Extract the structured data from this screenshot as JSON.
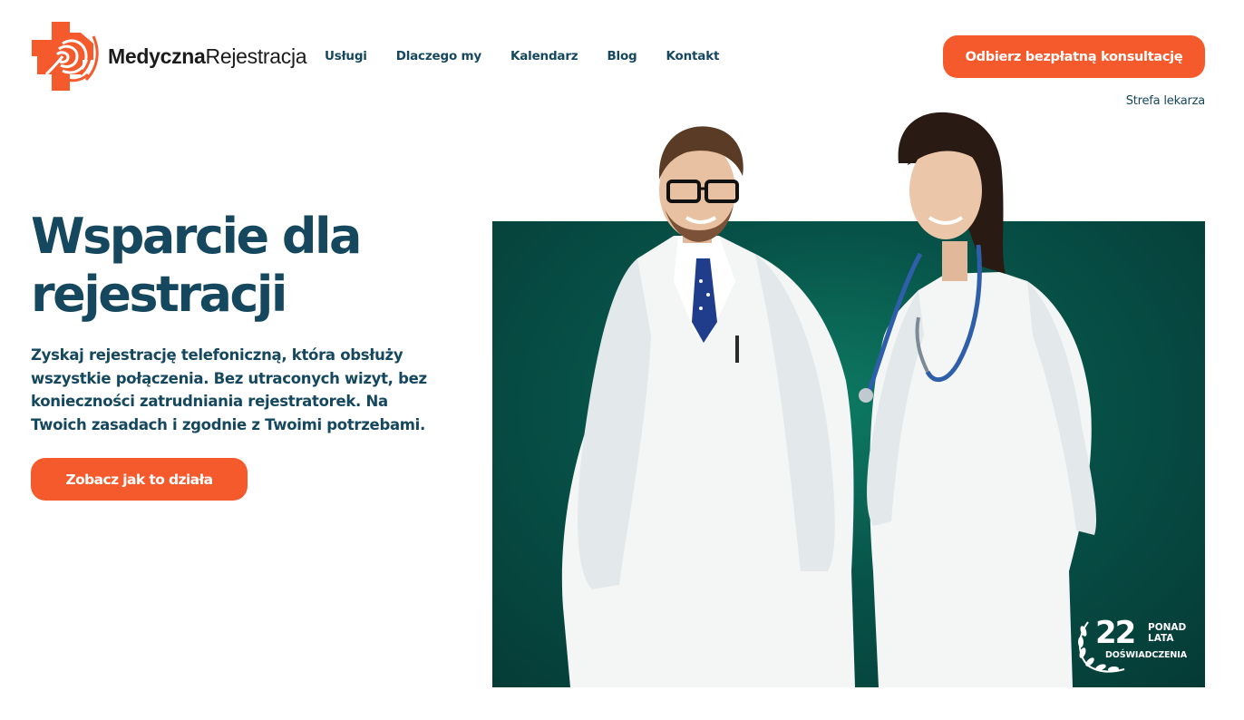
{
  "brand": {
    "name_bold": "Medyczna",
    "name_regular": "Rejestracja",
    "accent_color": "#f55a2c",
    "text_color": "#15485e"
  },
  "nav": {
    "items": [
      {
        "label": "Usługi"
      },
      {
        "label": "Dlaczego my"
      },
      {
        "label": "Kalendarz"
      },
      {
        "label": "Blog"
      },
      {
        "label": "Kontakt"
      }
    ]
  },
  "header": {
    "cta_label": "Odbierz bezpłatną konsultację",
    "doctor_zone_label": "Strefa lekarza"
  },
  "hero": {
    "title_line1": "Wsparcie dla",
    "title_line2": "rejestracji",
    "description": "Zyskaj rejestrację telefoniczną, która obsłuży wszystkie połączenia. Bez utraconych wizyt, bez konieczności zatrudniania rejestratorek. Na Twoich zasadach i zgodnie z Twoimi potrzebami.",
    "cta_label": "Zobacz jak to działa",
    "image_bg_color": "#075248"
  },
  "badge": {
    "number": "22",
    "line1": "PONAD",
    "line2": "LATA",
    "line3": "DOŚWIADCZENIA"
  }
}
